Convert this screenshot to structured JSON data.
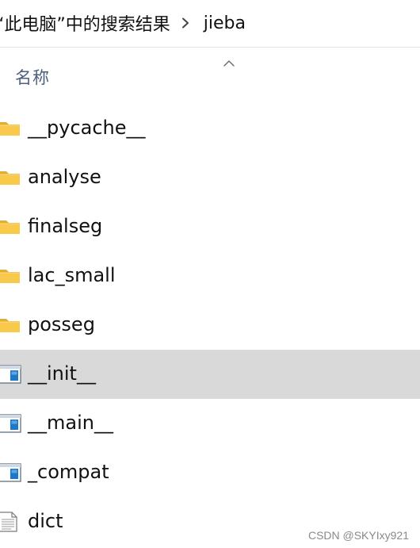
{
  "breadcrumb": {
    "search_scope": "“此电脑”中的搜索结果",
    "current_folder": "jieba",
    "separator_icon": "chevron-right-icon"
  },
  "column_header": {
    "name_label": "名称",
    "sort_icon": "sort-ascending-icon"
  },
  "files": [
    {
      "name": "__pycache__",
      "type": "folder",
      "icon": "folder-icon",
      "selected": false
    },
    {
      "name": "analyse",
      "type": "folder",
      "icon": "folder-icon",
      "selected": false
    },
    {
      "name": "finalseg",
      "type": "folder",
      "icon": "folder-icon",
      "selected": false
    },
    {
      "name": "lac_small",
      "type": "folder",
      "icon": "folder-icon",
      "selected": false
    },
    {
      "name": "posseg",
      "type": "folder",
      "icon": "folder-icon",
      "selected": false
    },
    {
      "name": "__init__",
      "type": "python-file",
      "icon": "python-file-icon",
      "selected": true
    },
    {
      "name": "__main__",
      "type": "python-file",
      "icon": "python-file-icon",
      "selected": false
    },
    {
      "name": "_compat",
      "type": "python-file",
      "icon": "python-file-icon",
      "selected": false
    },
    {
      "name": "dict",
      "type": "text-file",
      "icon": "text-file-icon",
      "selected": false
    }
  ],
  "colors": {
    "selection_background": "#d9d9d9",
    "folder_yellow": "#f8c94a",
    "header_text": "#4c607a",
    "python_icon_blue": "#1e78c8"
  },
  "watermark": "CSDN @SKYIxy921"
}
